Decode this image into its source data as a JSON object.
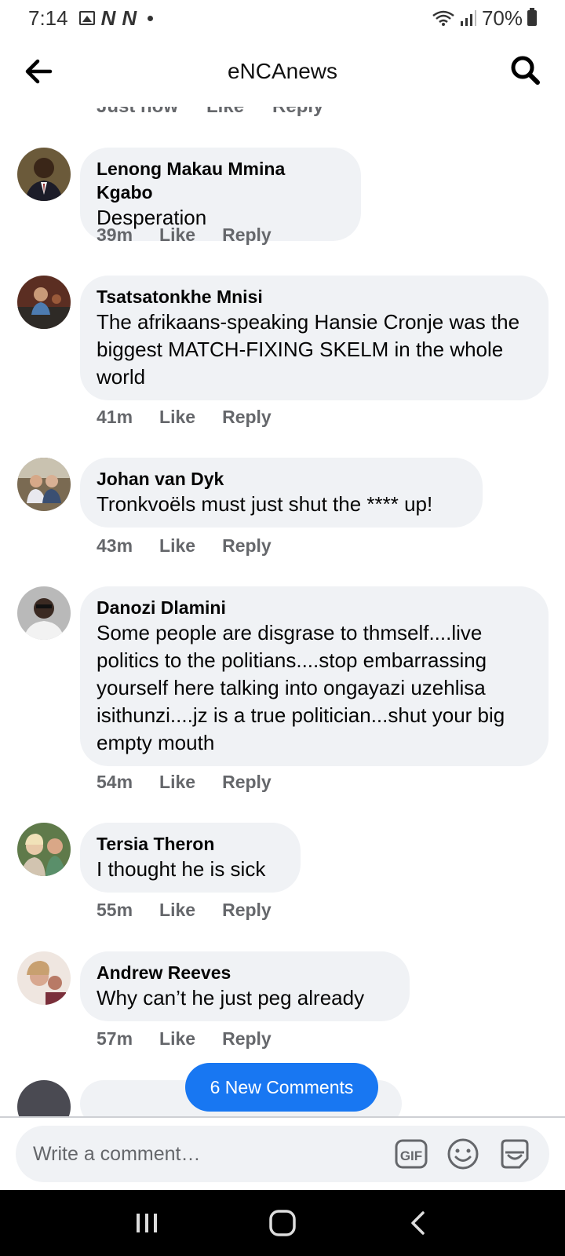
{
  "status_bar": {
    "time": "7:14",
    "battery": "70%",
    "notif_letters": [
      "N",
      "N"
    ]
  },
  "header": {
    "title": "eNCAnews"
  },
  "partial_top_meta": {
    "time": "Just now",
    "like": "Like",
    "reply": "Reply"
  },
  "comments": [
    {
      "author": "Lenong Makau Mmina Kgabo",
      "text": "Desperation",
      "time": "39m",
      "like": "Like",
      "reply": "Reply"
    },
    {
      "author": "Tsatsatonkhe Mnisi",
      "text": "The afrikaans-speaking Hansie Cronje was the biggest MATCH-FIXING SKELM in the whole world",
      "time": "41m",
      "like": "Like",
      "reply": "Reply"
    },
    {
      "author": "Johan van Dyk",
      "text": "Tronkvoëls must just shut the **** up!",
      "time": "43m",
      "like": "Like",
      "reply": "Reply"
    },
    {
      "author": "Danozi Dlamini",
      "text": "Some people are disgrase to thmself....live politics to the politians....stop embarrassing yourself here talking into ongayazi uzehlisa isithunzi....jz is a true politician...shut your big empty mouth",
      "time": "54m",
      "like": "Like",
      "reply": "Reply"
    },
    {
      "author": "Tersia Theron",
      "text": "I thought he is sick",
      "time": "55m",
      "like": "Like",
      "reply": "Reply"
    },
    {
      "author": "Andrew Reeves",
      "text": "Why can’t he just peg already",
      "time": "57m",
      "like": "Like",
      "reply": "Reply"
    }
  ],
  "new_comments_button": "6 New Comments",
  "composer": {
    "placeholder": "Write a comment…"
  },
  "colors": {
    "accent": "#1877f2",
    "bubble": "#f0f2f5",
    "meta": "#65676b"
  },
  "icons": [
    "back-arrow-icon",
    "search-icon",
    "gif-icon",
    "emoji-icon",
    "sticker-icon",
    "recent-apps-icon",
    "home-icon",
    "back-icon"
  ]
}
